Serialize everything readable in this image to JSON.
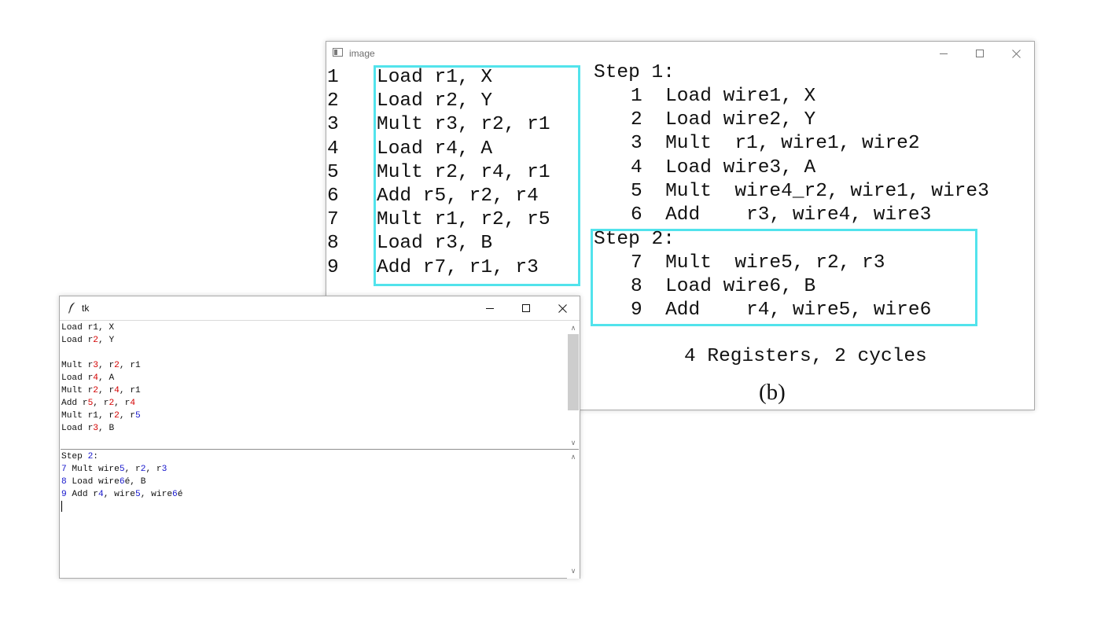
{
  "image_window": {
    "title": "image",
    "minimize": "—",
    "maximize": "☐",
    "close": "✕",
    "left_lines": [
      {
        "num": "1",
        "code": "Load r1, X"
      },
      {
        "num": "2",
        "code": "Load r2, Y"
      },
      {
        "num": "3",
        "code": "Mult r3, r2, r1"
      },
      {
        "num": "4",
        "code": "Load r4, A"
      },
      {
        "num": "5",
        "code": "Mult r2, r4, r1"
      },
      {
        "num": "6",
        "code": "Add r5, r2, r4"
      },
      {
        "num": "7",
        "code": "Mult r1, r2, r5"
      },
      {
        "num": "8",
        "code": "Load r3, B"
      },
      {
        "num": "9",
        "code": "Add r7, r1, r3"
      }
    ],
    "step1_header": "Step 1:",
    "step1_lines": [
      {
        "num": "1",
        "op": "Load",
        "args": "wire1, X"
      },
      {
        "num": "2",
        "op": "Load",
        "args": "wire2, Y"
      },
      {
        "num": "3",
        "op": "Mult",
        "args": " r1, wire1, wire2"
      },
      {
        "num": "4",
        "op": "Load",
        "args": "wire3, A"
      },
      {
        "num": "5",
        "op": "Mult",
        "args": " wire4_r2, wire1, wire3"
      },
      {
        "num": "6",
        "op": "Add",
        "args": "  r3, wire4, wire3"
      }
    ],
    "step2_header": "Step 2:",
    "step2_lines": [
      {
        "num": "7",
        "op": "Mult",
        "args": " wire5, r2, r3"
      },
      {
        "num": "8",
        "op": "Load",
        "args": "wire6, B"
      },
      {
        "num": "9",
        "op": "Add",
        "args": "  r4, wire5, wire6"
      }
    ],
    "summary": "4 Registers, 2 cycles",
    "caption": "(b)",
    "box_color": "#52e3ec"
  },
  "tk_window": {
    "title": "tk",
    "icon": "feather-icon",
    "minimize": "—",
    "maximize": "☐",
    "close": "✕",
    "top_pane_lines": [
      [
        {
          "t": "Load r1, X",
          "c": ""
        }
      ],
      [
        {
          "t": "Load r",
          "c": ""
        },
        {
          "t": "2",
          "c": "red"
        },
        {
          "t": ", Y",
          "c": ""
        }
      ],
      [],
      [
        {
          "t": "Mult r",
          "c": ""
        },
        {
          "t": "3",
          "c": "red"
        },
        {
          "t": ", r",
          "c": ""
        },
        {
          "t": "2",
          "c": "red"
        },
        {
          "t": ", r1",
          "c": ""
        }
      ],
      [
        {
          "t": "Load r",
          "c": ""
        },
        {
          "t": "4",
          "c": "red"
        },
        {
          "t": ", A",
          "c": ""
        }
      ],
      [
        {
          "t": "Mult r",
          "c": ""
        },
        {
          "t": "2",
          "c": "red"
        },
        {
          "t": ", r",
          "c": ""
        },
        {
          "t": "4",
          "c": "red"
        },
        {
          "t": ", r1",
          "c": ""
        }
      ],
      [
        {
          "t": "Add r",
          "c": ""
        },
        {
          "t": "5",
          "c": "red"
        },
        {
          "t": ", r",
          "c": ""
        },
        {
          "t": "2",
          "c": "red"
        },
        {
          "t": ", r",
          "c": ""
        },
        {
          "t": "4",
          "c": "red"
        }
      ],
      [
        {
          "t": "Mult r1, r",
          "c": ""
        },
        {
          "t": "2",
          "c": "red"
        },
        {
          "t": ", r",
          "c": ""
        },
        {
          "t": "5",
          "c": "blue"
        }
      ],
      [
        {
          "t": "Load r",
          "c": ""
        },
        {
          "t": "3",
          "c": "red"
        },
        {
          "t": ", B",
          "c": ""
        }
      ]
    ],
    "bottom_pane_lines": [
      [
        {
          "t": "Step ",
          "c": ""
        },
        {
          "t": "2",
          "c": "blue"
        },
        {
          "t": ":",
          "c": ""
        }
      ],
      [
        {
          "t": "7",
          "c": "blue"
        },
        {
          "t": " Mult wire",
          "c": ""
        },
        {
          "t": "5",
          "c": "blue"
        },
        {
          "t": ", r",
          "c": ""
        },
        {
          "t": "2",
          "c": "blue"
        },
        {
          "t": ", r",
          "c": ""
        },
        {
          "t": "3",
          "c": "blue"
        }
      ],
      [
        {
          "t": "8",
          "c": "blue"
        },
        {
          "t": " Load wire",
          "c": ""
        },
        {
          "t": "6",
          "c": "blue"
        },
        {
          "t": "é, B",
          "c": ""
        }
      ],
      [
        {
          "t": "9",
          "c": "blue"
        },
        {
          "t": " Add r",
          "c": ""
        },
        {
          "t": "4",
          "c": "blue"
        },
        {
          "t": ", wire",
          "c": ""
        },
        {
          "t": "5",
          "c": "blue"
        },
        {
          "t": ", wire",
          "c": ""
        },
        {
          "t": "6",
          "c": "blue"
        },
        {
          "t": "é",
          "c": ""
        }
      ]
    ],
    "colors": {
      "red": "#d40000",
      "blue": "#1515cc"
    },
    "scroll_up": "∧",
    "scroll_down": "∨"
  }
}
